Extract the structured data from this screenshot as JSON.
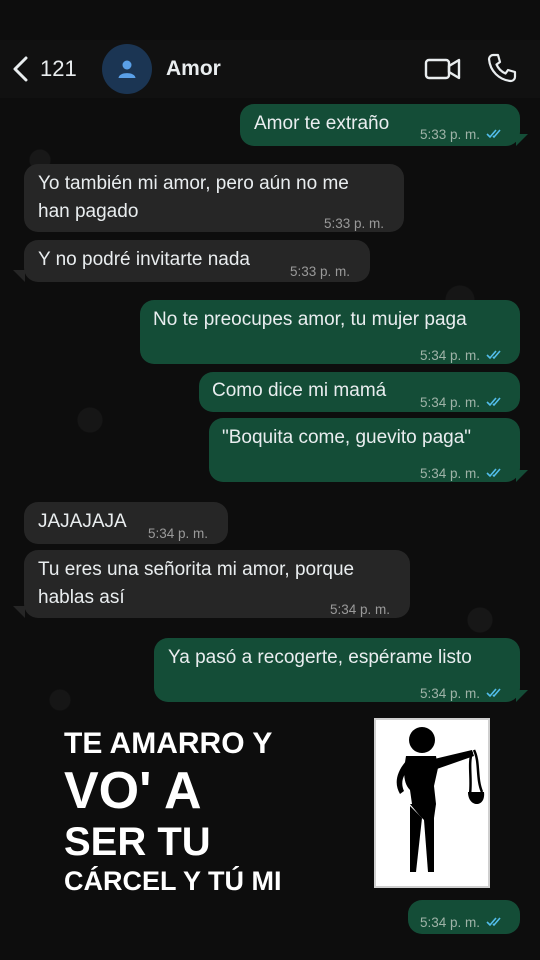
{
  "header": {
    "back_count": "121",
    "contact_name": "Amor",
    "icons": [
      "back-chevron-icon",
      "person-icon",
      "video-camera-icon",
      "phone-icon"
    ],
    "avatar_color": "#1b3553"
  },
  "colors": {
    "outgoing_bubble": "#144d37",
    "incoming_bubble": "#262626",
    "read_ticks": "#53bdeb"
  },
  "messages": [
    {
      "direction": "out",
      "lines": [
        "Amor te extraño"
      ],
      "time": "5:33 p. m.",
      "status": "read"
    },
    {
      "direction": "in",
      "lines": [
        "Yo también mi amor, pero aún no me",
        "han pagado"
      ],
      "time": "5:33 p. m."
    },
    {
      "direction": "in",
      "lines": [
        "Y no podré invitarte nada"
      ],
      "time": "5:33 p. m."
    },
    {
      "direction": "out",
      "lines": [
        "No te preocupes amor, tu mujer paga"
      ],
      "time": "5:34 p. m.",
      "status": "read"
    },
    {
      "direction": "out",
      "lines": [
        "Como dice mi mamá"
      ],
      "time": "5:34 p. m.",
      "status": "read"
    },
    {
      "direction": "out",
      "lines": [
        "\"Boquita come, guevito paga\""
      ],
      "time": "5:34 p. m.",
      "status": "read"
    },
    {
      "direction": "in",
      "lines": [
        "JAJAJAJA"
      ],
      "time": "5:34 p. m."
    },
    {
      "direction": "in",
      "lines": [
        "Tu eres una señorita mi amor, porque",
        "hablas así"
      ],
      "time": "5:34 p. m."
    },
    {
      "direction": "out",
      "lines": [
        "Ya pasó a recogerte, espérame listo"
      ],
      "time": "5:34 p. m.",
      "status": "read"
    }
  ],
  "sticker": {
    "lines": [
      "TE AMARRO Y",
      "VO' A",
      "SER TU",
      "CÁRCEL Y TÚ MI"
    ],
    "image": "woman-holding-bra-icon"
  },
  "last_message": {
    "direction": "out",
    "time": "5:34 p. m.",
    "status": "read"
  }
}
